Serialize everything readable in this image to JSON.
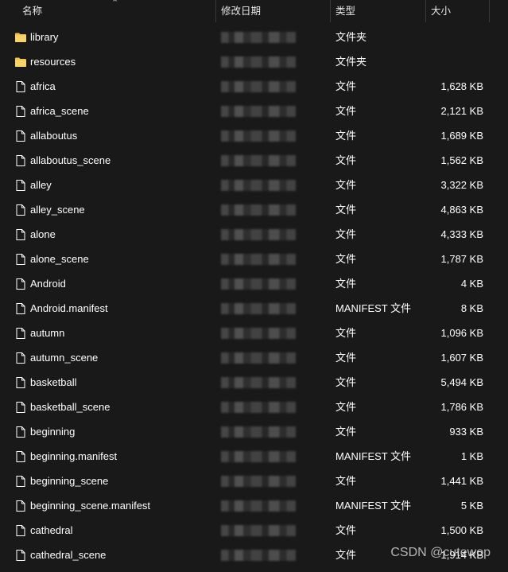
{
  "header": {
    "name_label": "名称",
    "date_label": "修改日期",
    "type_label": "类型",
    "size_label": "大小"
  },
  "files": [
    {
      "name": "library",
      "type": "文件夹",
      "size": "",
      "icon": "folder-icon"
    },
    {
      "name": "resources",
      "type": "文件夹",
      "size": "",
      "icon": "folder-icon"
    },
    {
      "name": "africa",
      "type": "文件",
      "size": "1,628 KB",
      "icon": "file-icon"
    },
    {
      "name": "africa_scene",
      "type": "文件",
      "size": "2,121 KB",
      "icon": "file-icon"
    },
    {
      "name": "allaboutus",
      "type": "文件",
      "size": "1,689 KB",
      "icon": "file-icon"
    },
    {
      "name": "allaboutus_scene",
      "type": "文件",
      "size": "1,562 KB",
      "icon": "file-icon"
    },
    {
      "name": "alley",
      "type": "文件",
      "size": "3,322 KB",
      "icon": "file-icon"
    },
    {
      "name": "alley_scene",
      "type": "文件",
      "size": "4,863 KB",
      "icon": "file-icon"
    },
    {
      "name": "alone",
      "type": "文件",
      "size": "4,333 KB",
      "icon": "file-icon"
    },
    {
      "name": "alone_scene",
      "type": "文件",
      "size": "1,787 KB",
      "icon": "file-icon"
    },
    {
      "name": "Android",
      "type": "文件",
      "size": "4 KB",
      "icon": "file-icon"
    },
    {
      "name": "Android.manifest",
      "type": "MANIFEST 文件",
      "size": "8 KB",
      "icon": "file-icon"
    },
    {
      "name": "autumn",
      "type": "文件",
      "size": "1,096 KB",
      "icon": "file-icon"
    },
    {
      "name": "autumn_scene",
      "type": "文件",
      "size": "1,607 KB",
      "icon": "file-icon"
    },
    {
      "name": "basketball",
      "type": "文件",
      "size": "5,494 KB",
      "icon": "file-icon"
    },
    {
      "name": "basketball_scene",
      "type": "文件",
      "size": "1,786 KB",
      "icon": "file-icon"
    },
    {
      "name": "beginning",
      "type": "文件",
      "size": "933 KB",
      "icon": "file-icon"
    },
    {
      "name": "beginning.manifest",
      "type": "MANIFEST 文件",
      "size": "1 KB",
      "icon": "file-icon"
    },
    {
      "name": "beginning_scene",
      "type": "文件",
      "size": "1,441 KB",
      "icon": "file-icon"
    },
    {
      "name": "beginning_scene.manifest",
      "type": "MANIFEST 文件",
      "size": "5 KB",
      "icon": "file-icon"
    },
    {
      "name": "cathedral",
      "type": "文件",
      "size": "1,500 KB",
      "icon": "file-icon"
    },
    {
      "name": "cathedral_scene",
      "type": "文件",
      "size": "1,914 KB",
      "icon": "file-icon"
    }
  ],
  "watermark": "CSDN @cutewop",
  "colors": {
    "background": "#191919",
    "folder": "#f2c14e",
    "text": "#ffffff"
  }
}
